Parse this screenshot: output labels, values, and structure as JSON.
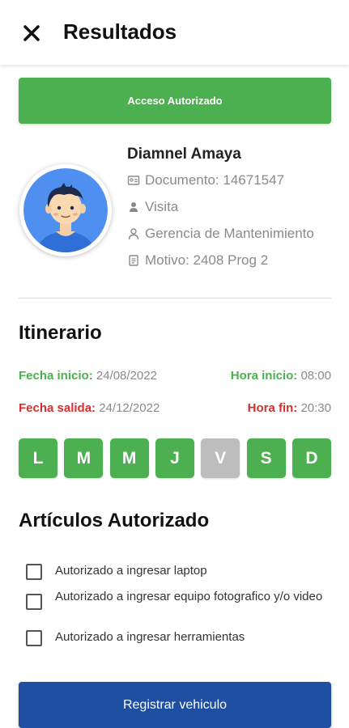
{
  "header": {
    "title": "Resultados"
  },
  "access_status": {
    "label": "Acceso Autorizado",
    "color": "#4caf50"
  },
  "person": {
    "name": "Diamnel Amaya",
    "document": "Documento: 14671547",
    "visit_type": "Visita",
    "department": "Gerencia de Mantenimiento",
    "reason": "Motivo: 2408 Prog 2"
  },
  "itinerary": {
    "title": "Itinerario",
    "start_date_label": "Fecha inicio:",
    "start_date": "24/08/2022",
    "start_time_label": "Hora inicio:",
    "start_time": "08:00",
    "end_date_label": "Fecha salida:",
    "end_date": "24/12/2022",
    "end_time_label": "Hora fin:",
    "end_time": "20:30",
    "days": [
      {
        "label": "L",
        "active": true
      },
      {
        "label": "M",
        "active": true
      },
      {
        "label": "M",
        "active": true
      },
      {
        "label": "J",
        "active": true
      },
      {
        "label": "V",
        "active": false
      },
      {
        "label": "S",
        "active": true
      },
      {
        "label": "D",
        "active": true
      }
    ]
  },
  "articles": {
    "title": "Artículos Autorizado",
    "items": [
      {
        "label": "Autorizado a ingresar laptop",
        "checked": false
      },
      {
        "label": "Autorizado a ingresar equipo fotografico y/o video",
        "checked": false
      },
      {
        "label": "Autorizado a ingresar herramientas",
        "checked": false
      }
    ]
  },
  "actions": {
    "register_label": "Registrar vehiculo"
  },
  "colors": {
    "green": "#4caf50",
    "red": "#d32f2f",
    "blue": "#1e4fa0",
    "inactive_day": "#bdbdbd"
  },
  "icons": [
    "close-icon",
    "id-card-icon",
    "visitor-icon",
    "person-icon",
    "document-icon",
    "avatar-illustration"
  ]
}
